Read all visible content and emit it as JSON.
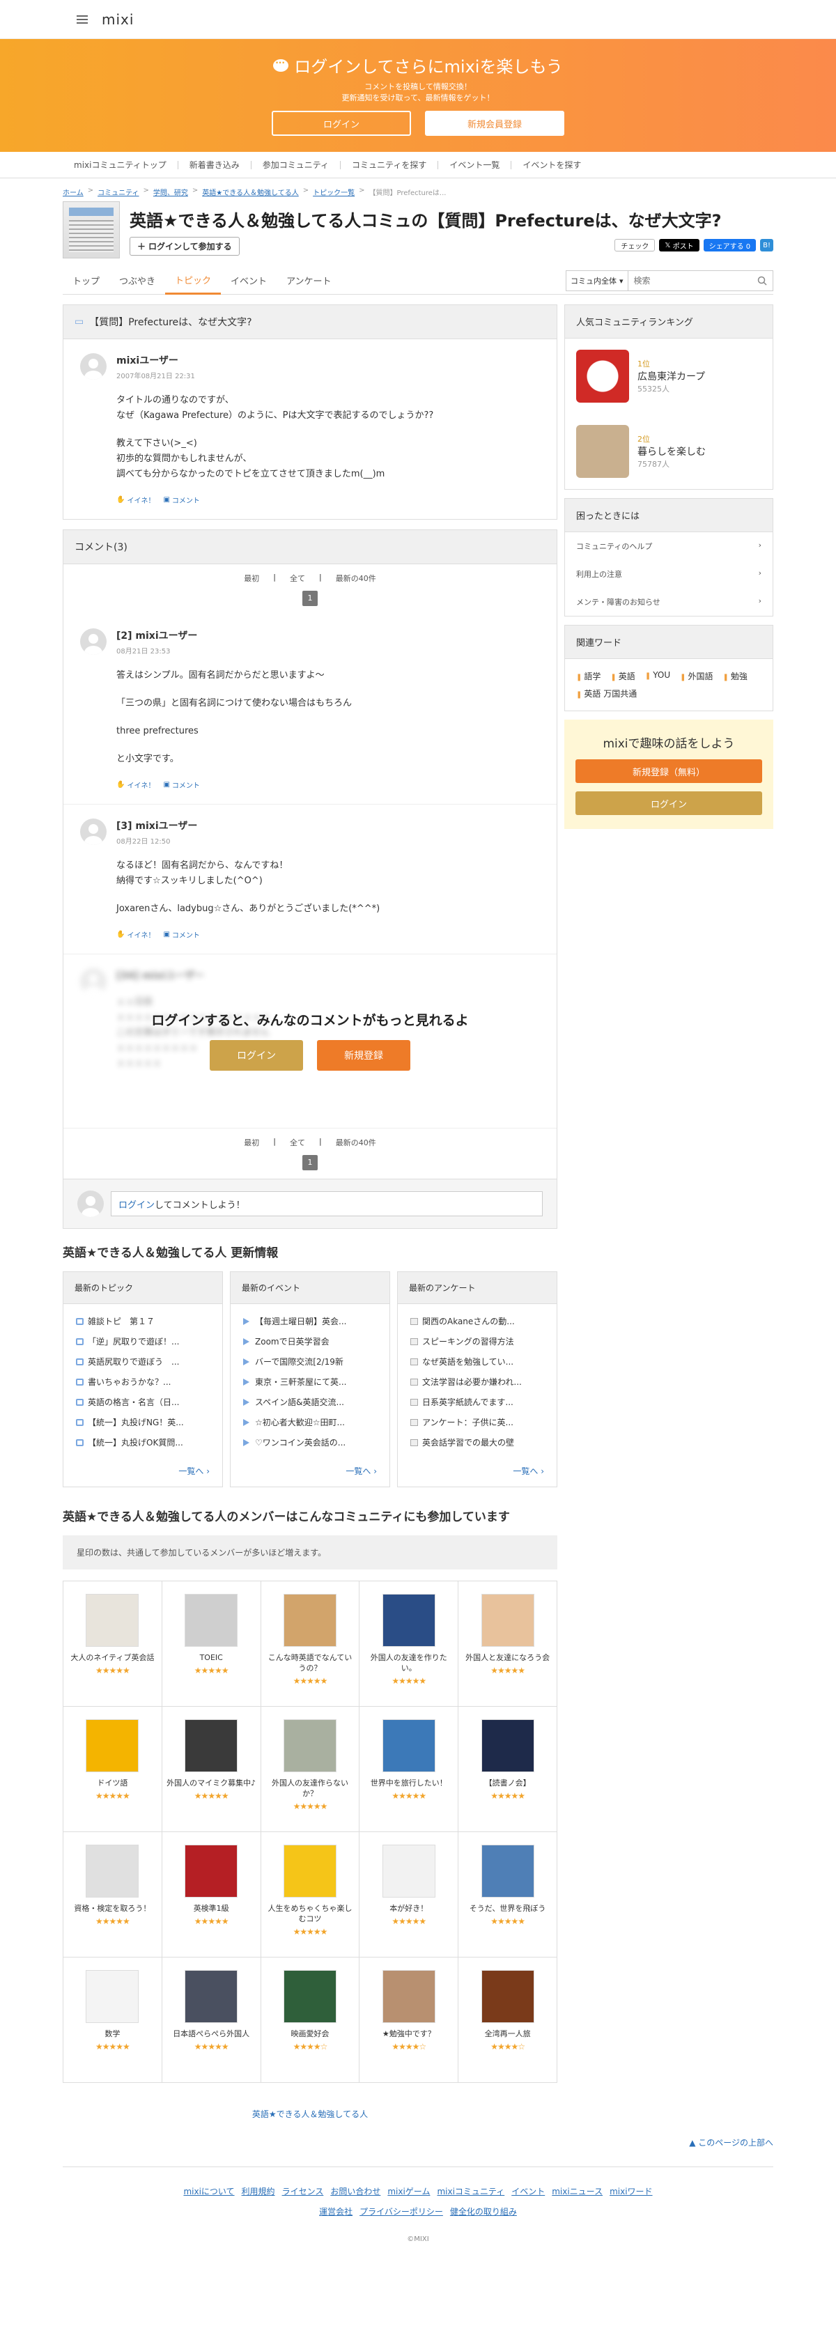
{
  "header": {
    "logo": "mixi"
  },
  "banner": {
    "title": "ログインしてさらにmixiを楽しもう",
    "sub1": "コメントを投稿して情報交換！",
    "sub2": "更新通知を受け取って、最新情報をゲット！",
    "login": "ログイン",
    "register": "新規会員登録"
  },
  "nav": [
    "mixiコミュニティトップ",
    "新着書き込み",
    "参加コミュニティ",
    "コミュニティを探す",
    "イベント一覧",
    "イベントを探す"
  ],
  "breadcrumb": [
    "ホーム",
    "コミュニティ",
    "学問、研究",
    "英語★できる人＆勉強してる人",
    "トピック一覧",
    "【質問】Prefectureは..."
  ],
  "community": {
    "title": "英語★できる人＆勉強してる人コミュの【質問】Prefectureは、なぜ大文字?",
    "join": "ログインして参加する"
  },
  "share": {
    "check": "チェック",
    "post": "ポスト",
    "fb": "シェアする 0",
    "mx": "B!"
  },
  "tabs": [
    "トップ",
    "つぶやき",
    "トピック",
    "イベント",
    "アンケート"
  ],
  "search": {
    "scope": "コミュ内全体",
    "placeholder": "検索"
  },
  "topic": {
    "title": "【質問】Prefectureは、なぜ大文字?",
    "user": "mixiユーザー",
    "date": "2007年08月21日 22:31",
    "lines": [
      "タイトルの通りなのですが、",
      "なぜ（Kagawa Prefecture）のように、Pは大文字で表記するのでしょうか??",
      "教えて下さい(>_<)",
      "初歩的な質問かもしれませんが、",
      "調べても分からなかったのでトピを立てさせて頂きましたm(__)m"
    ],
    "like": "イイネ！",
    "comment": "コメント"
  },
  "comments": {
    "header": "コメント(3)",
    "first": "最初",
    "all": "全て",
    "latest": "最新の40件",
    "page": "1",
    "c2": {
      "user": "[2] mixiユーザー",
      "date": "08月21日 23:53",
      "p1": "答えはシンプル。固有名詞だからだと思いますよ〜",
      "p2": "「三つの県」と固有名詞につけて使わない場合はもちろん",
      "p3": "three prefrectures",
      "p4": "と小文字です。"
    },
    "c3": {
      "user": "[3] mixiユーザー",
      "date": "08月22日 12:50",
      "p1": "なるほど！固有名詞だから、なんですね！",
      "p2": "納得です☆スッキリしました(^O^)",
      "p3": "Joxarenさん、ladybug☆さん、ありがとうございました(*^^*)"
    },
    "c4": {
      "user": "[34] mixiユーザー",
      "date": "",
      "l1": "ｘｘ日目",
      "l2": "ｘｘｘｘｘｘｘｘｘｘｘｘｘｘｘｘｘ",
      "l3": "この文章はダミーです表示されません",
      "l4": "ｘｘｘｘｘｘｘｘｘ",
      "l5": "ｘｘｘｘｘ"
    },
    "locked": "ログインすると、みんなのコメントがもっと見れるよ",
    "login": "ログイン",
    "register": "新規登録",
    "box_link": "ログイン",
    "box_text": "してコメントしよう！"
  },
  "side": {
    "ranking_title": "人気コミュニティランキング",
    "r1_rank": "1位",
    "r1_name": "広島東洋カープ",
    "r1_count": "55325人",
    "r2_rank": "2位",
    "r2_name": "暮らしを楽しむ",
    "r2_count": "75787人",
    "help_title": "困ったときには",
    "help": [
      "コミュニティのヘルプ",
      "利用上の注意",
      "メンテ・障害のお知らせ"
    ],
    "kw_title": "関連ワード",
    "keywords": [
      "語学",
      "英語",
      "YOU",
      "外国語",
      "勉強",
      "英語 万国共通"
    ],
    "promo_title": "mixiで趣味の話をしよう",
    "promo_reg": "新規登録（無料）",
    "promo_login": "ログイン"
  },
  "updates": {
    "title": "英語★できる人＆勉強してる人 更新情報",
    "topics_title": "最新のトピック",
    "topics": [
      "雑談トピ　第１７",
      "「逆」尻取りで遊ぼ！...",
      "英語尻取りで遊ぼう　...",
      "書いちゃおうかな？...",
      "英語の格言・名言（日...",
      "【統一】丸投げNG！英...",
      "【統一】丸投げOK質問..."
    ],
    "events_title": "最新のイベント",
    "events": [
      "【毎週土曜日朝】英会...",
      "Zoomで日英学習会",
      "バーで国際交流[2/19新",
      "東京・三軒茶屋にて英...",
      "スペイン語&英語交流...",
      "☆初心者大歓迎☆田町...",
      "♡ワンコイン英会話の..."
    ],
    "enq_title": "最新のアンケート",
    "enq": [
      "関西のAkaneさんの動...",
      "スピーキングの習得方法",
      "なぜ英語を勉強してい...",
      "文法学習は必要か嫌われ...",
      "日系英字紙読んでます...",
      "アンケート：子供に英...",
      "英会話学習での最大の壁"
    ],
    "more": "一覧へ"
  },
  "members": {
    "title": "英語★できる人＆勉強してる人のメンバーはこんなコミュニティにも参加しています",
    "note": "星印の数は、共通して参加しているメンバーが多いほど増えます。",
    "items": [
      {
        "name": "大人のネイティブ英会話",
        "stars": "★★★★★",
        "color": "#e8e4dc"
      },
      {
        "name": "TOEIC",
        "stars": "★★★★★",
        "color": "#cfcfcf"
      },
      {
        "name": "こんな時英語でなんていうの？",
        "stars": "★★★★★",
        "color": "#d2a46b"
      },
      {
        "name": "外国人の友達を作りたい。",
        "stars": "★★★★★",
        "color": "#2a4d86"
      },
      {
        "name": "外国人と友達になろう会",
        "stars": "★★★★★",
        "color": "#e8c29c"
      },
      {
        "name": "ドイツ語",
        "stars": "★★★★★",
        "color": "#f4b400"
      },
      {
        "name": "外国人のマイミク募集中♪",
        "stars": "★★★★★",
        "color": "#3a3a3a"
      },
      {
        "name": "外国人の友達作らないか？",
        "stars": "★★★★★",
        "color": "#a9b0a0"
      },
      {
        "name": "世界中を旅行したい！",
        "stars": "★★★★★",
        "color": "#3c79b8"
      },
      {
        "name": "【読書ノ会】",
        "stars": "★★★★★",
        "color": "#1e2a4a"
      },
      {
        "name": "資格・検定を取ろう！",
        "stars": "★★★★★",
        "color": "#e0e0e0"
      },
      {
        "name": "英検準1級",
        "stars": "★★★★★",
        "color": "#b51f24"
      },
      {
        "name": "人生をめちゃくちゃ楽しむコツ",
        "stars": "★★★★★",
        "color": "#f5c518"
      },
      {
        "name": "本が好き！",
        "stars": "★★★★★",
        "color": "#f2f2f2"
      },
      {
        "name": "そうだ、世界を飛ぼう",
        "stars": "★★★★★",
        "color": "#4f7fb6"
      },
      {
        "name": "数学",
        "stars": "★★★★★",
        "color": "#f4f4f4"
      },
      {
        "name": "日本語ぺらぺら外国人",
        "stars": "★★★★★",
        "color": "#4a5060"
      },
      {
        "name": "映画愛好会",
        "stars": "★★★★☆",
        "color": "#2f5f3a"
      },
      {
        "name": "★勉強中です？",
        "stars": "★★★★☆",
        "color": "#b89070"
      },
      {
        "name": "全湾再一人旅",
        "stars": "★★★★☆",
        "color": "#7a3a1a"
      }
    ]
  },
  "footer": {
    "comm_link": "英語★できる人＆勉強してる人",
    "totop": "このページの上部へ",
    "links1": [
      "mixiについて",
      "利用規約",
      "ライセンス",
      "お問い合わせ",
      "mixiゲーム",
      "mixiコミュニティ",
      "イベント",
      "mixiニュース",
      "mixiワード"
    ],
    "links2": [
      "運営会社",
      "プライバシーポリシー",
      "健全化の取り組み"
    ],
    "copy": "©MIXI"
  }
}
